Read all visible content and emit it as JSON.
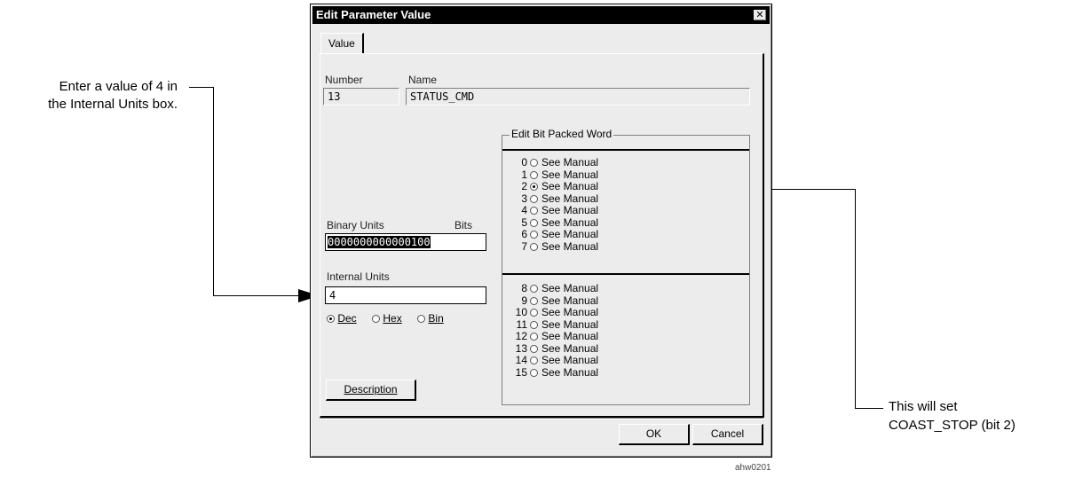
{
  "annotations": {
    "left_text_line1": "Enter a value of 4 in",
    "left_text_line2": "the Internal Units box.",
    "right_text_line1": "This will set",
    "right_text_line2": "COAST_STOP (bit 2)",
    "figure_id": "ahw0201"
  },
  "dialog": {
    "title": "Edit Parameter Value",
    "close_glyph": "✕",
    "tab": "Value",
    "number_label": "Number",
    "number_value": "13",
    "name_label": "Name",
    "name_value": "STATUS_CMD",
    "binary_units_label": "Binary Units",
    "bits_label": "Bits",
    "binary_value": "0000000000000100",
    "internal_units_label": "Internal Units",
    "internal_value": "4",
    "radix": {
      "dec": "Dec",
      "hex": "Hex",
      "bin": "Bin",
      "selected": "dec"
    },
    "description_button": "Description",
    "bit_group_title": "Edit Bit Packed Word",
    "bits_low": [
      {
        "n": "0",
        "label": "See Manual",
        "on": false
      },
      {
        "n": "1",
        "label": "See Manual",
        "on": false
      },
      {
        "n": "2",
        "label": "See Manual",
        "on": true
      },
      {
        "n": "3",
        "label": "See Manual",
        "on": false
      },
      {
        "n": "4",
        "label": "See Manual",
        "on": false
      },
      {
        "n": "5",
        "label": "See Manual",
        "on": false
      },
      {
        "n": "6",
        "label": "See Manual",
        "on": false
      },
      {
        "n": "7",
        "label": "See Manual",
        "on": false
      }
    ],
    "bits_high": [
      {
        "n": "8",
        "label": "See Manual",
        "on": false
      },
      {
        "n": "9",
        "label": "See Manual",
        "on": false
      },
      {
        "n": "10",
        "label": "See Manual",
        "on": false
      },
      {
        "n": "11",
        "label": "See Manual",
        "on": false
      },
      {
        "n": "12",
        "label": "See Manual",
        "on": false
      },
      {
        "n": "13",
        "label": "See Manual",
        "on": false
      },
      {
        "n": "14",
        "label": "See Manual",
        "on": false
      },
      {
        "n": "15",
        "label": "See Manual",
        "on": false
      }
    ],
    "ok_button": "OK",
    "cancel_button": "Cancel"
  }
}
